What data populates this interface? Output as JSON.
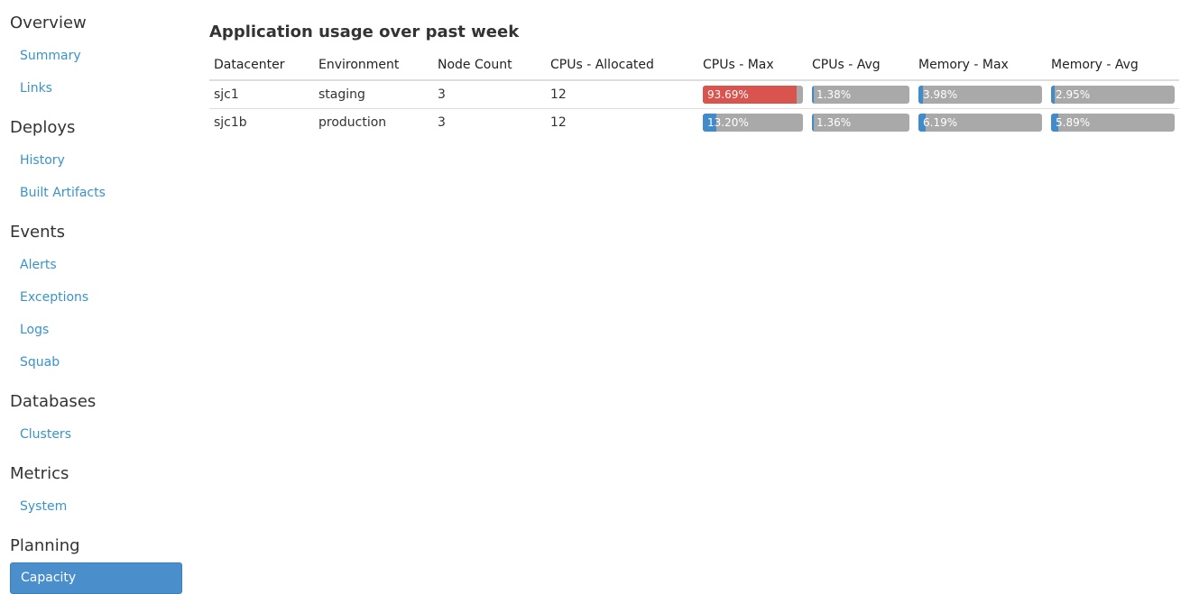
{
  "sidebar": {
    "sections": [
      {
        "title": "Overview",
        "items": [
          {
            "label": "Summary"
          },
          {
            "label": "Links"
          }
        ]
      },
      {
        "title": "Deploys",
        "items": [
          {
            "label": "History"
          },
          {
            "label": "Built Artifacts"
          }
        ]
      },
      {
        "title": "Events",
        "items": [
          {
            "label": "Alerts"
          },
          {
            "label": "Exceptions"
          },
          {
            "label": "Logs"
          },
          {
            "label": "Squab"
          }
        ]
      },
      {
        "title": "Databases",
        "items": [
          {
            "label": "Clusters"
          }
        ]
      },
      {
        "title": "Metrics",
        "items": [
          {
            "label": "System"
          }
        ]
      },
      {
        "title": "Planning",
        "items": [
          {
            "label": "Capacity",
            "active": true
          }
        ]
      }
    ]
  },
  "main": {
    "title": "Application usage over past week",
    "table": {
      "headers": [
        "Datacenter",
        "Environment",
        "Node Count",
        "CPUs - Allocated",
        "CPUs - Max",
        "CPUs - Avg",
        "Memory - Max",
        "Memory - Avg"
      ],
      "rows": [
        {
          "datacenter": "sjc1",
          "environment": "staging",
          "node_count": "3",
          "cpus_allocated": "12",
          "cpus_max": {
            "label": "93.69%",
            "value": 93.69,
            "status": "danger"
          },
          "cpus_avg": {
            "label": "1.38%",
            "value": 1.38,
            "status": "normal"
          },
          "memory_max": {
            "label": "3.98%",
            "value": 3.98,
            "status": "normal"
          },
          "memory_avg": {
            "label": "2.95%",
            "value": 2.95,
            "status": "normal"
          }
        },
        {
          "datacenter": "sjc1b",
          "environment": "production",
          "node_count": "3",
          "cpus_allocated": "12",
          "cpus_max": {
            "label": "13.20%",
            "value": 13.2,
            "status": "normal"
          },
          "cpus_avg": {
            "label": "1.36%",
            "value": 1.36,
            "status": "normal"
          },
          "memory_max": {
            "label": "6.19%",
            "value": 6.19,
            "status": "normal"
          },
          "memory_avg": {
            "label": "5.89%",
            "value": 5.89,
            "status": "normal"
          }
        }
      ]
    }
  },
  "colors": {
    "link": "#3a93c8",
    "active_bg": "#4a8fcb",
    "bar_normal": "#428bca",
    "bar_danger": "#d9534f",
    "bar_track": "#a9a9a9"
  }
}
